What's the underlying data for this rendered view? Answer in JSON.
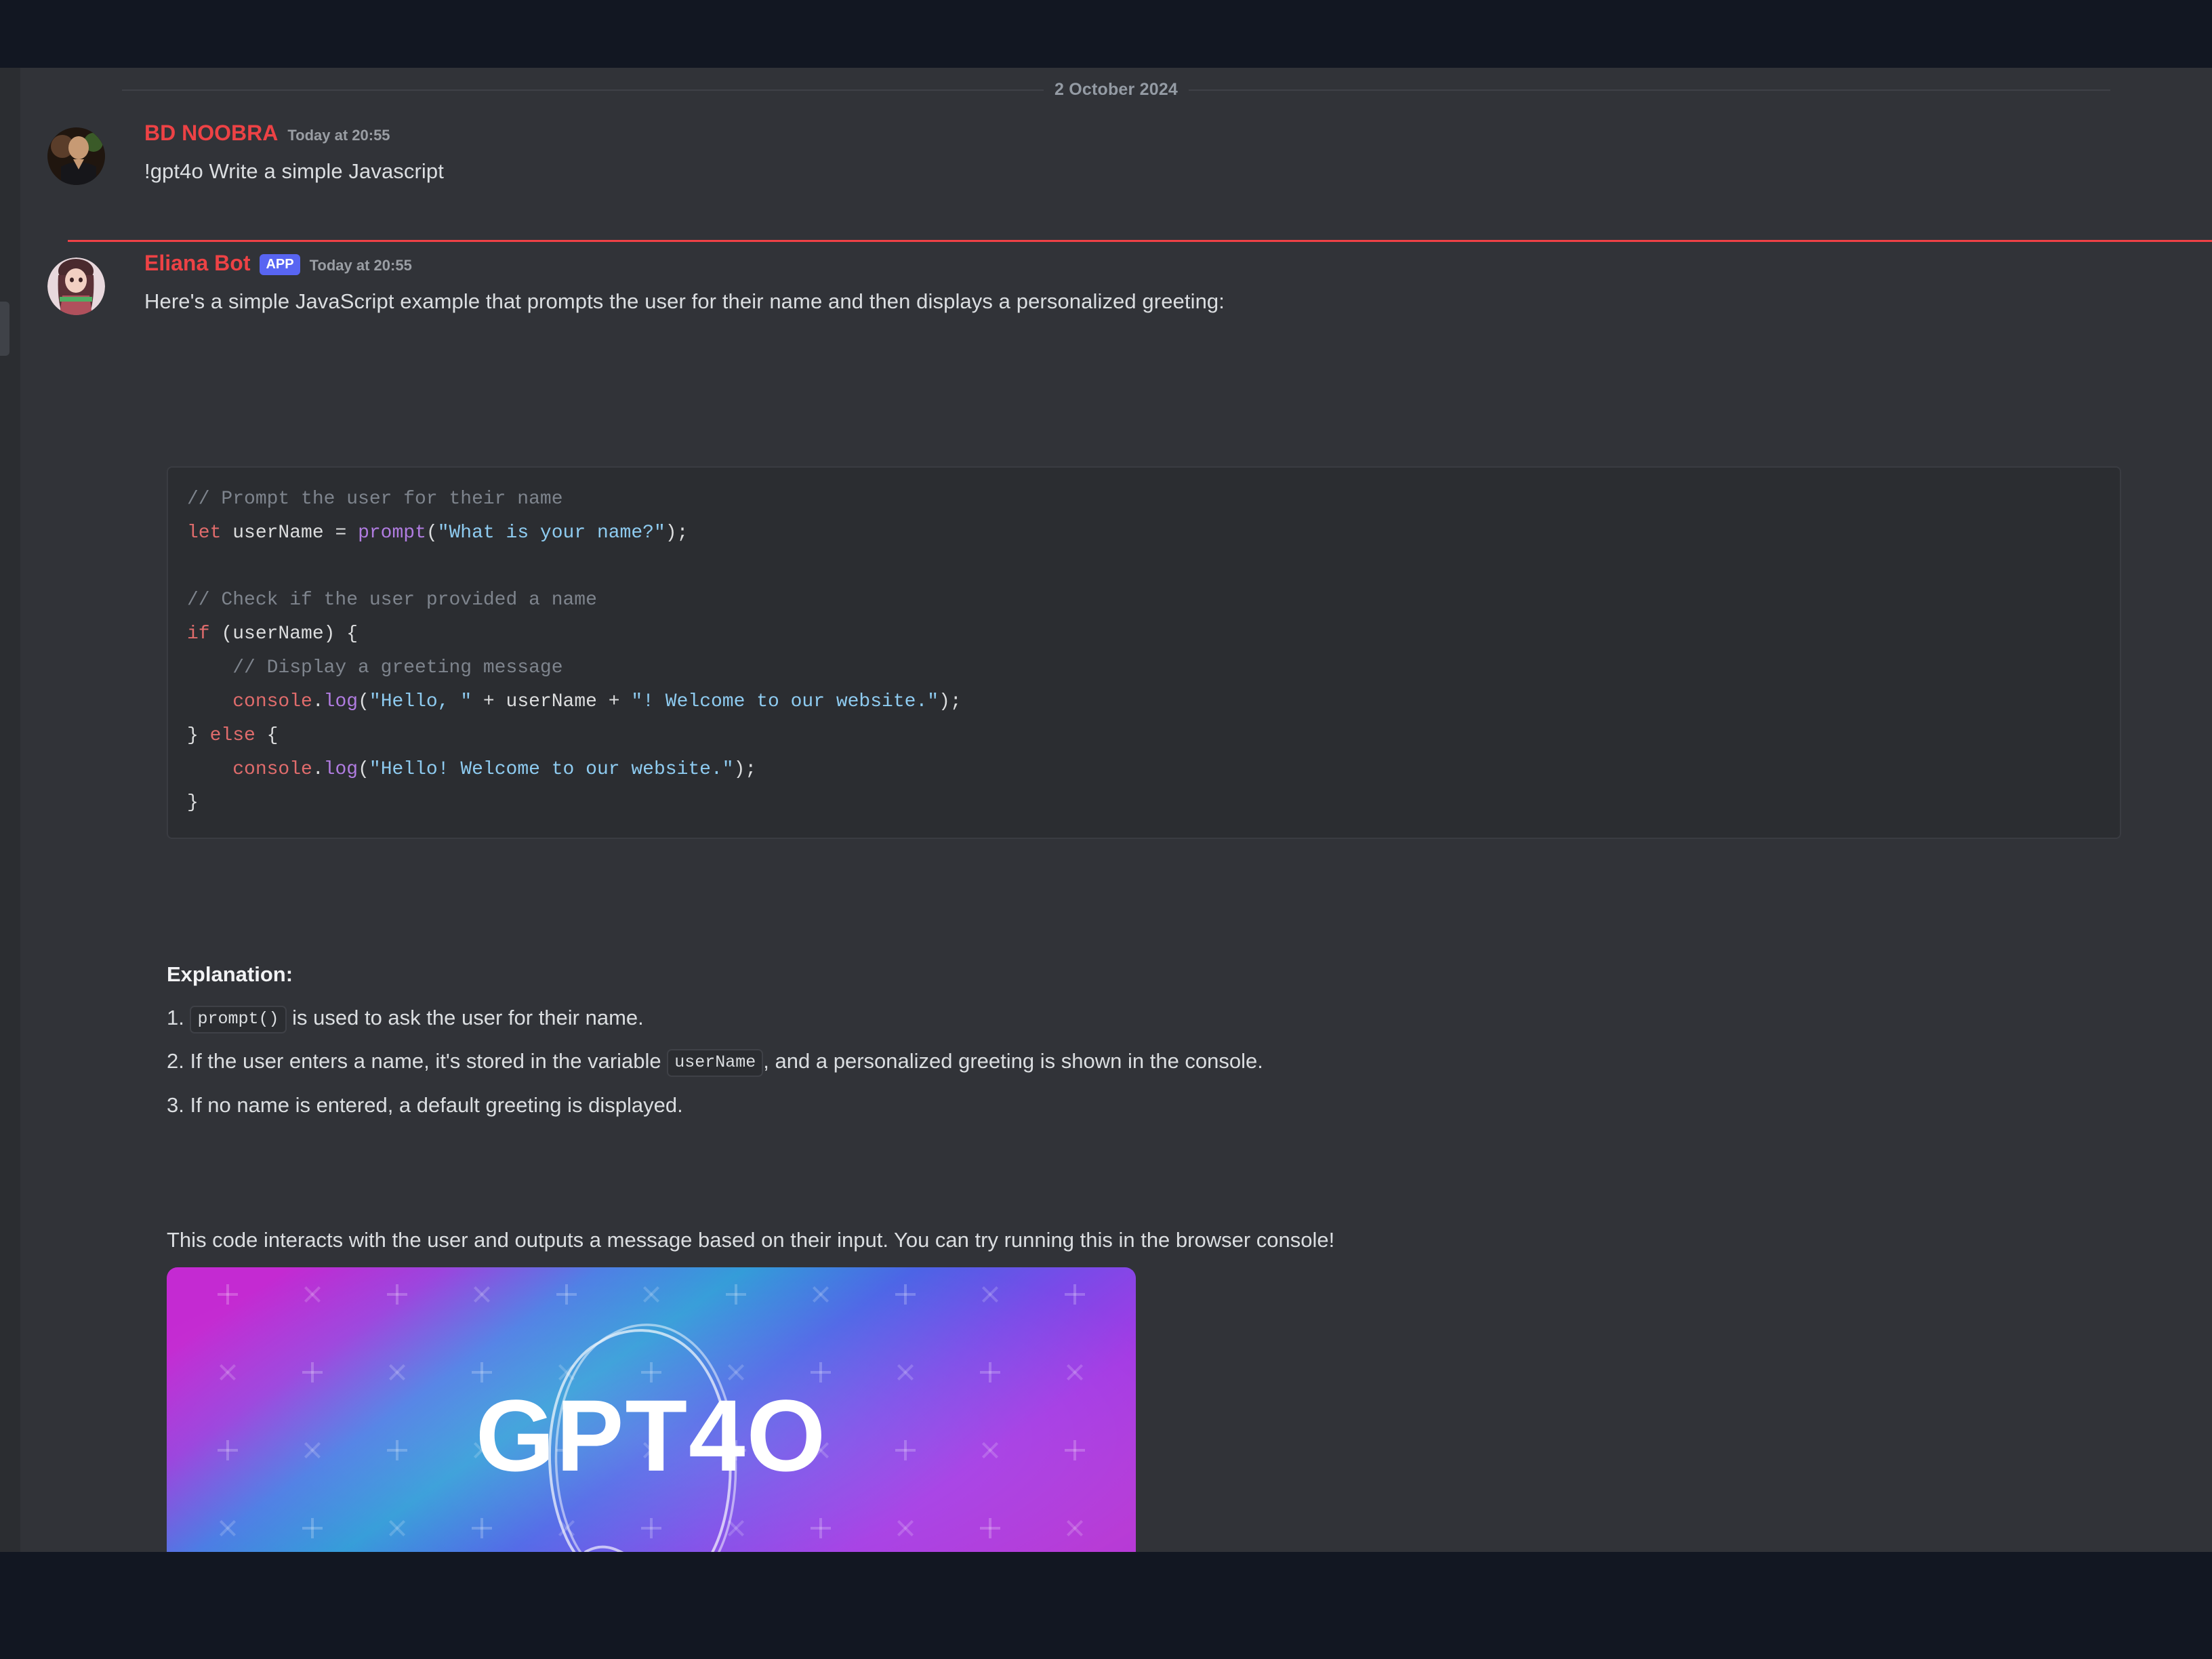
{
  "theme": {
    "chrome_bar_color": "#121722",
    "chat_background": "#313338",
    "rail_background": "#2b2d31",
    "author_color": "#ed4245",
    "app_badge_color": "#5865f2",
    "separator_color": "#ef4146",
    "code_background": "#2b2d31",
    "body_text_color": "#dbdee1",
    "timestamp_color": "#9a9ea4"
  },
  "date_divider": {
    "label": "2 October 2024"
  },
  "messages": [
    {
      "id": "user-message",
      "author": "BD NOOBRA",
      "timestamp": "Today at 20:55",
      "is_app": false,
      "text": "!gpt4o Write a simple Javascript",
      "avatar_icon": "user-avatar-photo"
    },
    {
      "id": "bot-message",
      "author": "Eliana Bot",
      "badge": "APP",
      "timestamp": "Today at 20:55",
      "is_app": true,
      "text": "Here's a simple JavaScript example that prompts the user for their name and then displays a personalized greeting:",
      "avatar_icon": "bot-avatar-photo"
    }
  ],
  "code_block": {
    "language": "javascript",
    "lines": [
      {
        "tokens": [
          {
            "t": "// Prompt the user for their name",
            "c": "c-com"
          }
        ]
      },
      {
        "tokens": [
          {
            "t": "let",
            "c": "c-kw"
          },
          {
            "t": " userName ",
            "c": "c-var"
          },
          {
            "t": "= ",
            "c": "c-punc"
          },
          {
            "t": "prompt",
            "c": "c-fn"
          },
          {
            "t": "(",
            "c": "c-punc"
          },
          {
            "t": "\"What is your name?\"",
            "c": "c-str"
          },
          {
            "t": ");",
            "c": "c-punc"
          }
        ]
      },
      {
        "tokens": [
          {
            "t": "",
            "c": "c-punc"
          }
        ]
      },
      {
        "tokens": [
          {
            "t": "// Check if the user provided a name",
            "c": "c-com"
          }
        ]
      },
      {
        "tokens": [
          {
            "t": "if",
            "c": "c-kw"
          },
          {
            "t": " (userName) {",
            "c": "c-punc"
          }
        ]
      },
      {
        "tokens": [
          {
            "t": "    // Display a greeting message",
            "c": "c-com"
          }
        ]
      },
      {
        "tokens": [
          {
            "t": "    console",
            "c": "c-id"
          },
          {
            "t": ".",
            "c": "c-punc"
          },
          {
            "t": "log",
            "c": "c-fn"
          },
          {
            "t": "(",
            "c": "c-punc"
          },
          {
            "t": "\"Hello, \"",
            "c": "c-str"
          },
          {
            "t": " + userName + ",
            "c": "c-var"
          },
          {
            "t": "\"! Welcome to our website.\"",
            "c": "c-str"
          },
          {
            "t": ");",
            "c": "c-punc"
          }
        ]
      },
      {
        "tokens": [
          {
            "t": "} ",
            "c": "c-punc"
          },
          {
            "t": "else",
            "c": "c-kw"
          },
          {
            "t": " {",
            "c": "c-punc"
          }
        ]
      },
      {
        "tokens": [
          {
            "t": "    console",
            "c": "c-id"
          },
          {
            "t": ".",
            "c": "c-punc"
          },
          {
            "t": "log",
            "c": "c-fn"
          },
          {
            "t": "(",
            "c": "c-punc"
          },
          {
            "t": "\"Hello! Welcome to our website.\"",
            "c": "c-str"
          },
          {
            "t": ");",
            "c": "c-punc"
          }
        ]
      },
      {
        "tokens": [
          {
            "t": "}",
            "c": "c-punc"
          }
        ]
      }
    ]
  },
  "explanation": {
    "title": "Explanation:",
    "items": [
      {
        "number": "1.",
        "chip_before": "prompt()",
        "text_after": " is used to ask the user for their name.",
        "text_before": ""
      },
      {
        "number": "2.",
        "text_before": " If the user enters a name, it's stored in the variable ",
        "chip_mid": "userName",
        "text_after": ", and a personalized greeting is shown in the console."
      },
      {
        "number": "3.",
        "text_before": " If no name is entered, a default greeting is displayed.",
        "text_after": ""
      }
    ]
  },
  "closing_paragraph": "This code interacts with the user and outputs a message based on their input. You can try running this in the browser console!",
  "attachment": {
    "name": "gpt4o-banner-image",
    "alt_text": "GPT4O",
    "title_text": "GPT4O",
    "gradient_stops": [
      "#c22fd4",
      "#7b4fe0",
      "#2f9fe0",
      "#4a5fe8",
      "#9b3fe8",
      "#b93fd8"
    ]
  }
}
